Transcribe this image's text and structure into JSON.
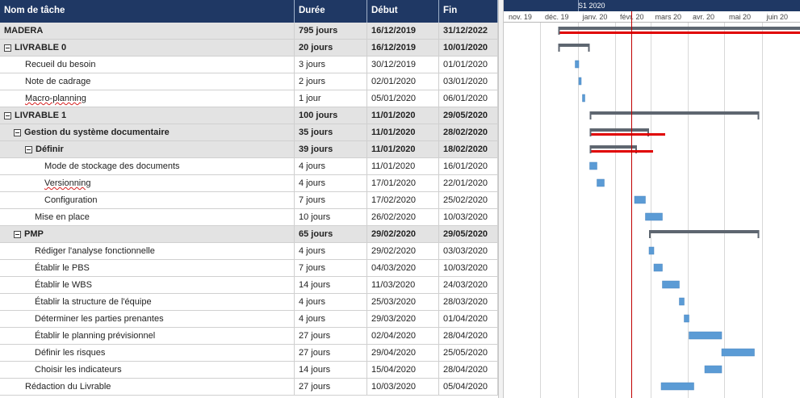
{
  "grid": {
    "headers": {
      "name": "Nom de tâche",
      "duration": "Durée",
      "start": "Début",
      "end": "Fin"
    },
    "rows": [
      {
        "name": "MADERA",
        "duration": "795 jours",
        "start": "16/12/2019",
        "end": "31/12/2022",
        "summary": true,
        "toggle": false,
        "indent": 0
      },
      {
        "name": "LIVRABLE 0",
        "duration": "20 jours",
        "start": "16/12/2019",
        "end": "10/01/2020",
        "summary": true,
        "toggle": true,
        "indent": 0
      },
      {
        "name": "Recueil du besoin",
        "duration": "3 jours",
        "start": "30/12/2019",
        "end": "01/01/2020",
        "summary": false,
        "toggle": false,
        "indent": 1
      },
      {
        "name": "Note de cadrage",
        "duration": "2 jours",
        "start": "02/01/2020",
        "end": "03/01/2020",
        "summary": false,
        "toggle": false,
        "indent": 1
      },
      {
        "name": "Macro-planning",
        "duration": "1 jour",
        "start": "05/01/2020",
        "end": "06/01/2020",
        "summary": false,
        "toggle": false,
        "indent": 1,
        "spell": true
      },
      {
        "name": "LIVRABLE 1",
        "duration": "100 jours",
        "start": "11/01/2020",
        "end": "29/05/2020",
        "summary": true,
        "toggle": true,
        "indent": 0
      },
      {
        "name": "Gestion du système documentaire",
        "duration": "35 jours",
        "start": "11/01/2020",
        "end": "28/02/2020",
        "summary": true,
        "toggle": true,
        "indent": 1
      },
      {
        "name": "Définir",
        "duration": "39 jours",
        "start": "11/01/2020",
        "end": "18/02/2020",
        "summary": true,
        "toggle": true,
        "indent": 2
      },
      {
        "name": "Mode de stockage des documents",
        "duration": "4 jours",
        "start": "11/01/2020",
        "end": "16/01/2020",
        "summary": false,
        "toggle": false,
        "indent": 3
      },
      {
        "name": "Versionning",
        "duration": "4 jours",
        "start": "17/01/2020",
        "end": "22/01/2020",
        "summary": false,
        "toggle": false,
        "indent": 3,
        "spell": true
      },
      {
        "name": "Configuration",
        "duration": "7 jours",
        "start": "17/02/2020",
        "end": "25/02/2020",
        "summary": false,
        "toggle": false,
        "indent": 3
      },
      {
        "name": "Mise en place",
        "duration": "10 jours",
        "start": "26/02/2020",
        "end": "10/03/2020",
        "summary": false,
        "toggle": false,
        "indent": 2
      },
      {
        "name": "PMP",
        "duration": "65 jours",
        "start": "29/02/2020",
        "end": "29/05/2020",
        "summary": true,
        "toggle": true,
        "indent": 1
      },
      {
        "name": "Rédiger l'analyse fonctionnelle",
        "duration": "4 jours",
        "start": "29/02/2020",
        "end": "03/03/2020",
        "summary": false,
        "toggle": false,
        "indent": 2
      },
      {
        "name": "Établir le PBS",
        "duration": "7 jours",
        "start": "04/03/2020",
        "end": "10/03/2020",
        "summary": false,
        "toggle": false,
        "indent": 2
      },
      {
        "name": "Établir le WBS",
        "duration": "14 jours",
        "start": "11/03/2020",
        "end": "24/03/2020",
        "summary": false,
        "toggle": false,
        "indent": 2
      },
      {
        "name": "Établir la structure de l'équipe",
        "duration": "4 jours",
        "start": "25/03/2020",
        "end": "28/03/2020",
        "summary": false,
        "toggle": false,
        "indent": 2
      },
      {
        "name": "Déterminer les parties prenantes",
        "duration": "4 jours",
        "start": "29/03/2020",
        "end": "01/04/2020",
        "summary": false,
        "toggle": false,
        "indent": 2
      },
      {
        "name": "Établir le planning prévisionnel",
        "duration": "27 jours",
        "start": "02/04/2020",
        "end": "28/04/2020",
        "summary": false,
        "toggle": false,
        "indent": 2
      },
      {
        "name": "Définir les risques",
        "duration": "27 jours",
        "start": "29/04/2020",
        "end": "25/05/2020",
        "summary": false,
        "toggle": false,
        "indent": 2
      },
      {
        "name": "Choisir les indicateurs",
        "duration": "14 jours",
        "start": "15/04/2020",
        "end": "28/04/2020",
        "summary": false,
        "toggle": false,
        "indent": 2
      },
      {
        "name": "Rédaction du Livrable",
        "duration": "27 jours",
        "start": "10/03/2020",
        "end": "05/04/2020",
        "summary": false,
        "toggle": false,
        "indent": 1
      }
    ]
  },
  "timescale": {
    "top_label": "S1 2020",
    "months": [
      "nov. 19",
      "déc. 19",
      "janv. 20",
      "févr. 20",
      "mars 20",
      "avr. 20",
      "mai 20",
      "juin 20"
    ]
  },
  "chart_data": {
    "type": "gantt",
    "today_marker": "2020-02-14",
    "colors": {
      "summary_bar": "#5e6670",
      "task_bar": "#5b9bd5",
      "critical": "#e00000",
      "today_line": "#c00000"
    },
    "bars": [
      {
        "task": "MADERA",
        "start": "2019-12-16",
        "end": "2022-12-31",
        "kind": "summary",
        "critical": true
      },
      {
        "task": "LIVRABLE 0",
        "start": "2019-12-16",
        "end": "2020-01-10",
        "kind": "summary",
        "critical": false
      },
      {
        "task": "Recueil du besoin",
        "start": "2019-12-30",
        "end": "2020-01-01",
        "kind": "task"
      },
      {
        "task": "Note de cadrage",
        "start": "2020-01-02",
        "end": "2020-01-03",
        "kind": "task"
      },
      {
        "task": "Macro-planning",
        "start": "2020-01-05",
        "end": "2020-01-06",
        "kind": "task"
      },
      {
        "task": "LIVRABLE 1",
        "start": "2020-01-11",
        "end": "2020-05-29",
        "kind": "summary",
        "critical": false
      },
      {
        "task": "Gestion du système documentaire",
        "start": "2020-01-11",
        "end": "2020-02-28",
        "kind": "summary",
        "critical": true
      },
      {
        "task": "Définir",
        "start": "2020-01-11",
        "end": "2020-02-18",
        "kind": "summary",
        "critical": true
      },
      {
        "task": "Mode de stockage des documents",
        "start": "2020-01-11",
        "end": "2020-01-16",
        "kind": "task"
      },
      {
        "task": "Versionning",
        "start": "2020-01-17",
        "end": "2020-01-22",
        "kind": "task"
      },
      {
        "task": "Configuration",
        "start": "2020-02-17",
        "end": "2020-02-25",
        "kind": "task"
      },
      {
        "task": "Mise en place",
        "start": "2020-02-26",
        "end": "2020-03-10",
        "kind": "task"
      },
      {
        "task": "PMP",
        "start": "2020-02-29",
        "end": "2020-05-29",
        "kind": "summary",
        "critical": false
      },
      {
        "task": "Rédiger l'analyse fonctionnelle",
        "start": "2020-02-29",
        "end": "2020-03-03",
        "kind": "task"
      },
      {
        "task": "Établir le PBS",
        "start": "2020-03-04",
        "end": "2020-03-10",
        "kind": "task"
      },
      {
        "task": "Établir le WBS",
        "start": "2020-03-11",
        "end": "2020-03-24",
        "kind": "task"
      },
      {
        "task": "Établir la structure de l'équipe",
        "start": "2020-03-25",
        "end": "2020-03-28",
        "kind": "task"
      },
      {
        "task": "Déterminer les parties prenantes",
        "start": "2020-03-29",
        "end": "2020-04-01",
        "kind": "task"
      },
      {
        "task": "Établir le planning prévisionnel",
        "start": "2020-04-02",
        "end": "2020-04-28",
        "kind": "task"
      },
      {
        "task": "Définir les risques",
        "start": "2020-04-29",
        "end": "2020-05-25",
        "kind": "task"
      },
      {
        "task": "Choisir les indicateurs",
        "start": "2020-04-15",
        "end": "2020-04-28",
        "kind": "task"
      },
      {
        "task": "Rédaction du Livrable",
        "start": "2020-03-10",
        "end": "2020-04-05",
        "kind": "task"
      }
    ]
  }
}
